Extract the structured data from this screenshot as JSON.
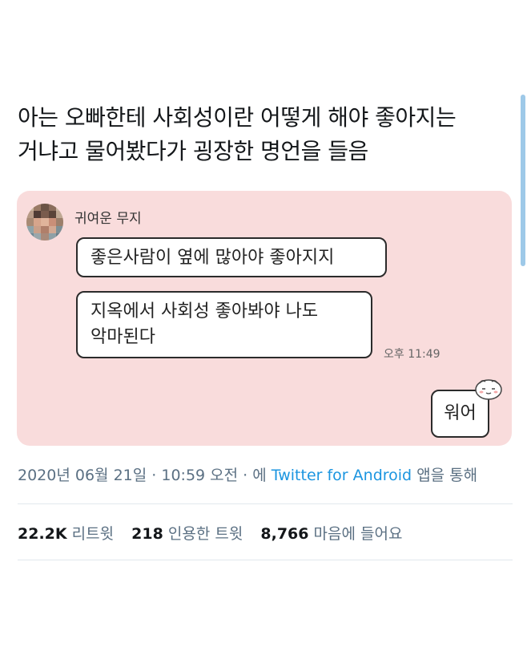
{
  "tweet": {
    "text_line1": "아는 오빠한테 사회성이란 어떻게 해야 좋아지는",
    "text_line2": "거냐고 물어봤다가 굉장한 명언을 들음"
  },
  "chat": {
    "sender": "귀여운 무지",
    "message1": "좋은사람이 옆에 많아야 좋아지지",
    "message2_line1": "지옥에서 사회성 좋아봐야 나도",
    "message2_line2": "악마된다",
    "time": "오후 11:49",
    "reply": "워어",
    "reply_icon": "emoji-face-icon"
  },
  "meta": {
    "date": "2020년 06월 21일",
    "sep1": " · ",
    "time": "10:59 오전",
    "sep2": " · 에 ",
    "source": "Twitter for Android",
    "suffix": " 앱을 통해"
  },
  "stats": {
    "retweets_count": "22.2K",
    "retweets_label": "리트윗",
    "quotes_count": "218",
    "quotes_label": "인용한 트윗",
    "likes_count": "8,766",
    "likes_label": "마음에 들어요"
  },
  "colors": {
    "card_bg": "#f9dcdc",
    "link": "#1b95e0",
    "meta_text": "#5b7083"
  }
}
